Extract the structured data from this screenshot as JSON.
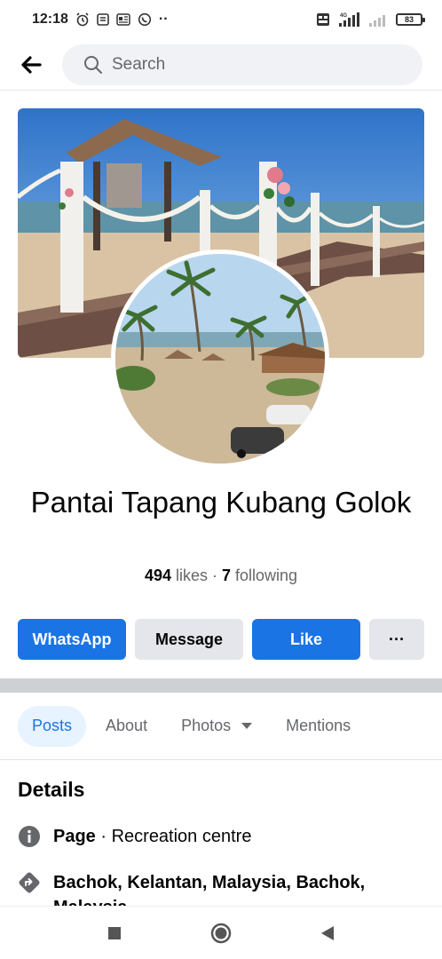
{
  "status_bar": {
    "time": "12:18",
    "dots": "··",
    "network": "4G",
    "battery": "83"
  },
  "header": {
    "search_placeholder": "Search"
  },
  "page": {
    "title": "Pantai Tapang Kubang Golok",
    "likes_count": "494",
    "likes_label": " likes",
    "separator": " · ",
    "following_count": "7",
    "following_label": " following"
  },
  "actions": {
    "whatsapp": "WhatsApp",
    "message": "Message",
    "like": "Like",
    "more": "···"
  },
  "tabs": [
    {
      "label": "Posts",
      "active": true
    },
    {
      "label": "About",
      "active": false
    },
    {
      "label": "Photos",
      "active": false
    },
    {
      "label": "Mentions",
      "active": false
    }
  ],
  "details": {
    "title": "Details",
    "category_label": "Page",
    "category_value": " · Recreation centre",
    "location": "Bachok, Kelantan, Malaysia, Bachok, Malaysia"
  },
  "colors": {
    "brand_blue": "#1b74e4",
    "secondary_gray": "#e4e6eb",
    "text_muted": "#65676b"
  }
}
